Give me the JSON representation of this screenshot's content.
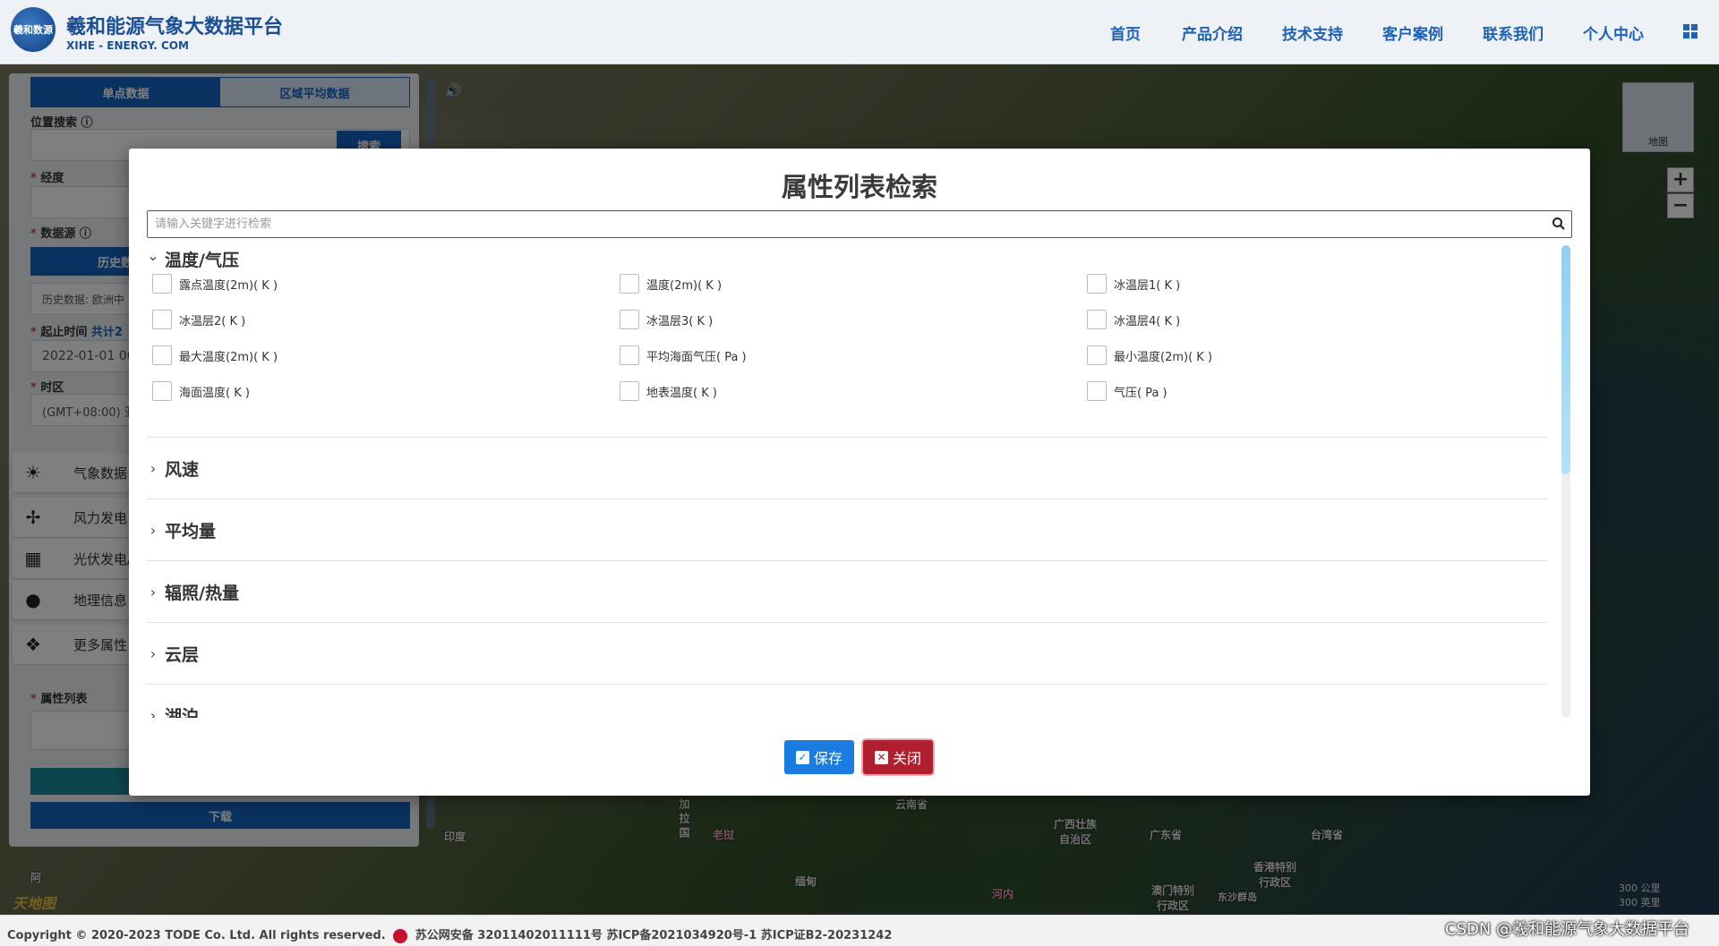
{
  "header": {
    "logo_text": "羲和数源",
    "brand_title": "羲和能源气象大数据平台",
    "brand_sub": "XIHE - ENERGY. COM",
    "nav": [
      "首页",
      "产品介绍",
      "技术支持",
      "客户案例",
      "联系我们",
      "个人中心"
    ]
  },
  "panel": {
    "tabs": [
      "单点数据",
      "区域平均数据"
    ],
    "location_label": "位置搜索",
    "search_btn": "搜索",
    "lon_label": "经度",
    "datasource_label": "数据源",
    "history_btn": "历史数",
    "datasource_value": "历史数据: 欧洲中",
    "time_label": "起止时间",
    "time_total": "共计2",
    "time_value": "2022-01-01 00",
    "tz_label": "时区",
    "tz_value": "(GMT+08:00) 亚",
    "side_items": [
      "气象数据",
      "风力发电",
      "光伏发电/",
      "地理信息",
      "更多属性"
    ],
    "attr_label": "属性列表",
    "download_btn": "下载"
  },
  "map": {
    "minimap_label": "地图",
    "zoom_in": "+",
    "zoom_out": "−",
    "labels": [
      "云南省",
      "广西壮族自治区",
      "广东省",
      "台湾省",
      "香港特别行政区",
      "澳门特别行政区",
      "东沙群岛",
      "缅甸",
      "印度",
      "加拉国",
      "老挝",
      "河内"
    ],
    "scale": [
      "300 公里",
      "300 英里"
    ],
    "tianditu": "天地图",
    "bottom_left": "阿"
  },
  "footer": {
    "copyright": "Copyright © 2020-2023 TODE Co. Ltd. All rights reserved.",
    "icp": "苏公网安备 32011402011111号 苏ICP备2021034920号-1 苏ICP证B2-20231242"
  },
  "watermark": "CSDN @羲和能源气象大数据平台",
  "modal": {
    "title": "属性列表检索",
    "search_placeholder": "请输入关键字进行检索",
    "groups": [
      {
        "name": "温度/气压",
        "expanded": true,
        "items": [
          [
            "露点温度(2m)( K )",
            "温度(2m)( K )",
            "冰温层1( K )"
          ],
          [
            "冰温层2( K )",
            "冰温层3( K )",
            "冰温层4( K )"
          ],
          [
            "最大温度(2m)( K )",
            "平均海面气压( Pa )",
            "最小温度(2m)( K )"
          ],
          [
            "海面温度( K )",
            "地表温度( K )",
            "气压( Pa )"
          ]
        ]
      },
      {
        "name": "风速",
        "expanded": false
      },
      {
        "name": "平均量",
        "expanded": false
      },
      {
        "name": "辐照/热量",
        "expanded": false
      },
      {
        "name": "云层",
        "expanded": false
      },
      {
        "name": "湖泊",
        "expanded": false
      }
    ],
    "save_label": "保存",
    "close_label": "关闭"
  },
  "colors": {
    "primary": "#1565c0",
    "save": "#1a7be0",
    "close": "#b01f2e"
  }
}
